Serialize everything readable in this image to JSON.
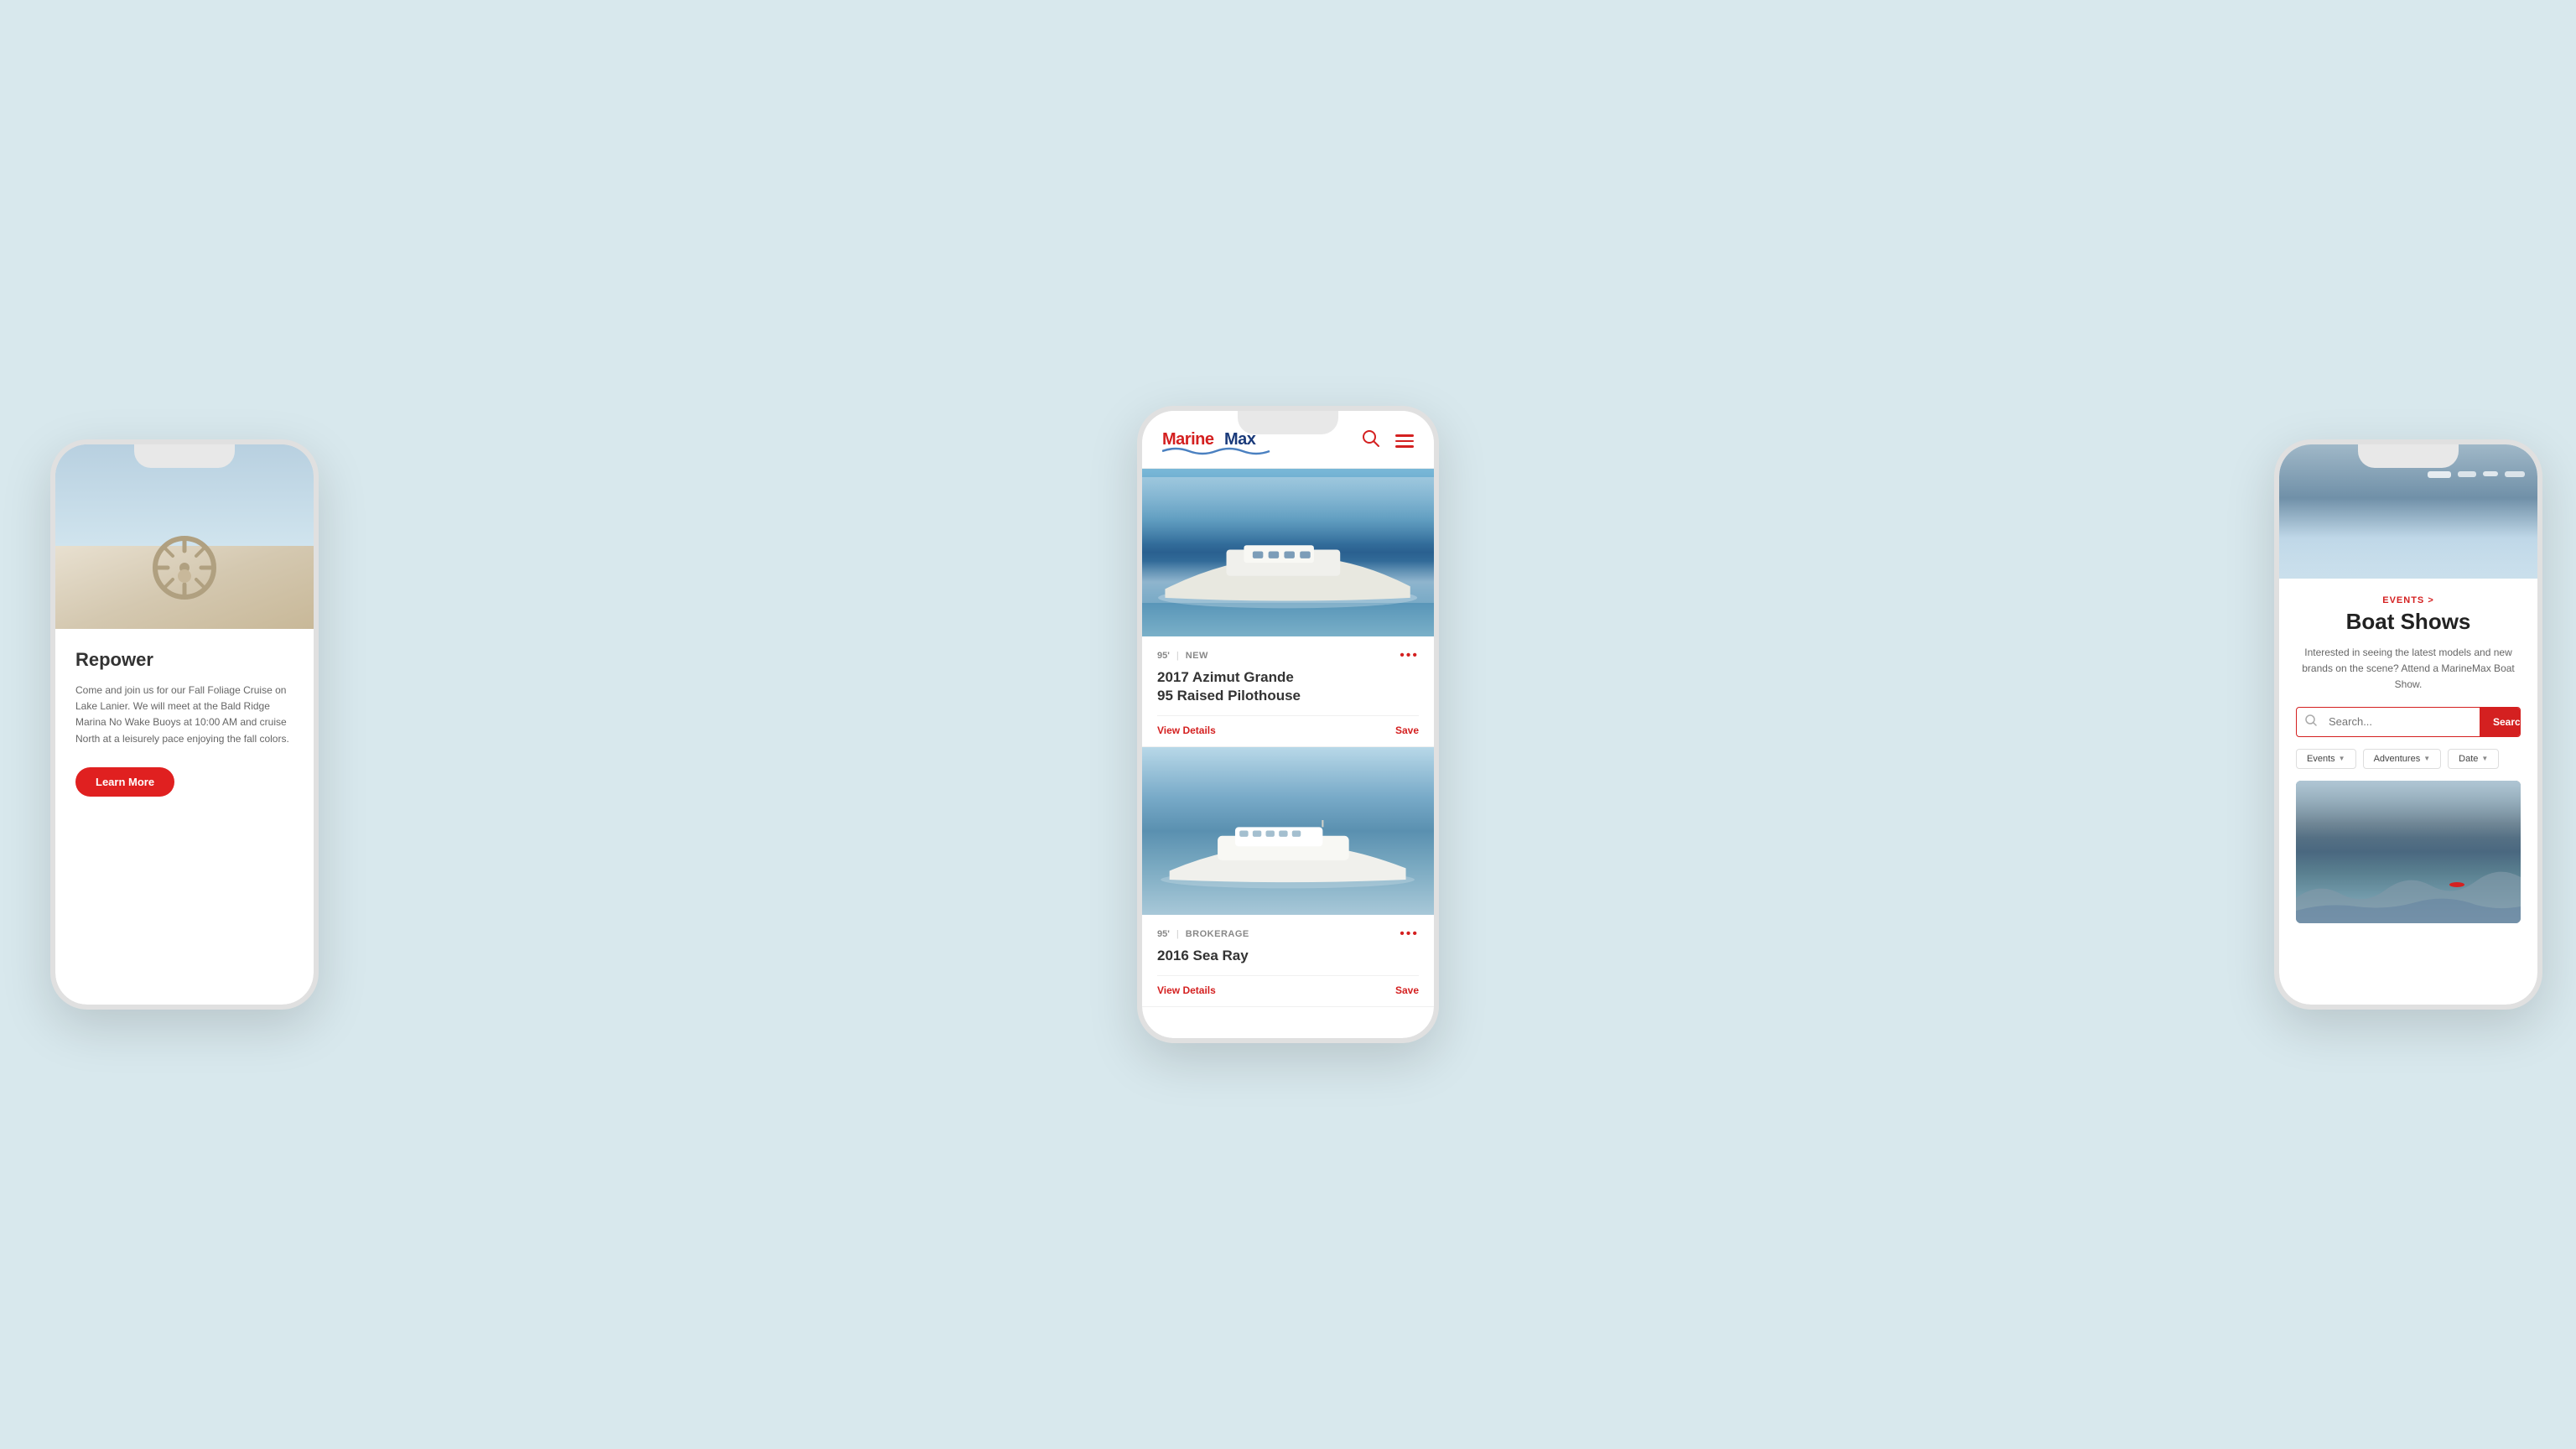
{
  "background": "#d8e8ed",
  "leftPhone": {
    "title": "Repower",
    "description": "Come and join us for our Fall Foliage Cruise on Lake Lanier. We will meet at the Bald Ridge Marina No Wake Buoys at 10:00 AM and cruise North at a leisurely pace enjoying the fall colors.",
    "learnMoreLabel": "Learn More",
    "buttonColor": "#e02020"
  },
  "centerPhone": {
    "logoText": "MARINEMAX",
    "listings": [
      {
        "size": "95'",
        "type": "NEW",
        "title": "2017 Azimut Grande\n95 Raised Pilothouse",
        "viewDetailsLabel": "View Details",
        "saveLabel": "Save"
      },
      {
        "size": "95'",
        "type": "BROKERAGE",
        "title": "2016 Sea Ray",
        "viewDetailsLabel": "View Details",
        "saveLabel": "Save"
      }
    ]
  },
  "rightPhone": {
    "eventsLabel": "EVENTS >",
    "boatShowsTitle": "Boat Shows",
    "description": "Interested in seeing the latest models and new brands on the scene? Attend a MarineMax Boat Show.",
    "searchPlaceholder": "Search...",
    "searchButtonLabel": "Search",
    "filters": [
      {
        "label": "Events"
      },
      {
        "label": "Adventures"
      },
      {
        "label": "Date"
      }
    ]
  }
}
